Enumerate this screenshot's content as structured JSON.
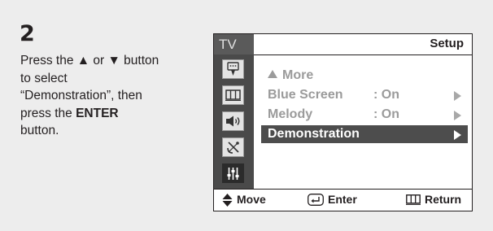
{
  "step": {
    "number": "2"
  },
  "instructions": {
    "line1_pre": "Press the ",
    "up_glyph": "▲",
    "mid": " or ",
    "down_glyph": "▼",
    "line1_post": " button",
    "line2": "to select",
    "line3": "“Demonstration”, then",
    "line4_pre": "press the ",
    "enter_word": "ENTER",
    "line5": "button."
  },
  "osd": {
    "source_label": "TV",
    "title": "Setup",
    "sidebar_icons": [
      "input-icon",
      "picture-icon",
      "sound-icon",
      "channel-icon",
      "setup-icon"
    ],
    "menu": [
      {
        "label": "More",
        "value": "",
        "has_up_arrow": true,
        "selected": false
      },
      {
        "label": "Blue Screen",
        "value": ": On",
        "selected": false
      },
      {
        "label": "Melody",
        "value": ": On",
        "selected": false
      },
      {
        "label": "Demonstration",
        "value": "",
        "selected": true
      }
    ],
    "bottom": {
      "move": "Move",
      "enter": "Enter",
      "return": "Return"
    }
  },
  "colors": {
    "panel_bg": "#ededed",
    "sidebar_bg": "#4a4a4a",
    "selected_row": "#4d4d4d",
    "dim_text": "#9b9b9b"
  }
}
